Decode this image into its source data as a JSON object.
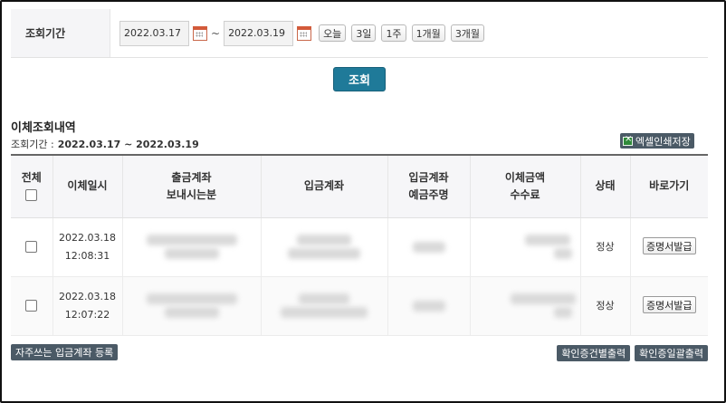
{
  "period": {
    "label": "조회기간",
    "start_date": "2022.03.17",
    "end_date": "2022.03.19",
    "separator": "~",
    "range_buttons": [
      "오늘",
      "3일",
      "1주",
      "1개월",
      "3개월"
    ]
  },
  "search_button": "조회",
  "results": {
    "title": "이체조회내역",
    "period_label": "조회기간 :",
    "period_value": "2022.03.17 ~ 2022.03.19",
    "excel_button": "엑셀인쇄저장"
  },
  "table": {
    "headers": {
      "select_all": "전체",
      "transfer_datetime": "이체일시",
      "withdraw_account": "출금계좌",
      "sender_name": "보내시는분",
      "deposit_account": "입금계좌",
      "deposit_bank": "입금계좌",
      "deposit_holder": "예금주명",
      "amount": "이체금액",
      "fee": "수수료",
      "status": "상태",
      "shortcut": "바로가기"
    },
    "rows": [
      {
        "date": "2022.03.18",
        "time": "12:08:31",
        "status": "정상",
        "action": "증명서발급"
      },
      {
        "date": "2022.03.18",
        "time": "12:07:22",
        "status": "정상",
        "action": "증명서발급"
      }
    ]
  },
  "bottom": {
    "register_frequent": "자주쓰는 입금계좌 등록",
    "print_individual": "확인증건별출력",
    "print_bulk": "확인증일괄출력"
  },
  "colors": {
    "primary_button": "#1f7a99",
    "dark_button": "#4b5a66"
  }
}
